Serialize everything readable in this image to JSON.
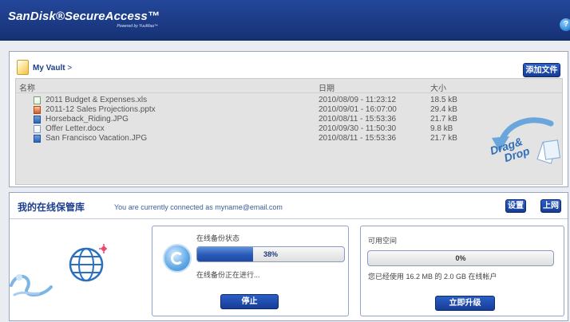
{
  "header": {
    "logo": "SanDisk®SecureAccess™",
    "logo_tagline": "Powered by YuuWaa™",
    "help_icon": "help-icon",
    "colors": {
      "bar": "#1c3b86"
    }
  },
  "vault": {
    "breadcrumb": "My Vault",
    "breadcrumb_separator": ">",
    "add_file_label": "添加文件",
    "columns": {
      "name": "名称",
      "date": "日期",
      "size": "大小"
    },
    "files": [
      {
        "icon": "xls-file-icon",
        "name": "2011 Budget & Expenses.xls",
        "date": "2010/08/09 - 11:23:12",
        "size": "18.5 kB"
      },
      {
        "icon": "ppt-file-icon",
        "name": "2011-12 Sales Projections.pptx",
        "date": "2010/09/01 - 16:07:00",
        "size": "29.4 kB"
      },
      {
        "icon": "jpg-file-icon",
        "name": "Horseback_Riding.JPG",
        "date": "2010/08/11 - 15:53:36",
        "size": "21.7 kB"
      },
      {
        "icon": "doc-file-icon",
        "name": "Offer Letter.docx",
        "date": "2010/09/30 - 11:50:30",
        "size": "9.8 kB"
      },
      {
        "icon": "jpg-file-icon",
        "name": "San Francisco Vacation.JPG",
        "date": "2010/08/11 - 15:53:36",
        "size": "21.7 kB"
      }
    ],
    "drag_drop": [
      "Drag&",
      "Drop"
    ]
  },
  "online": {
    "title": "我的在线保管库",
    "connection_text": "You are currently connected as myname@email.com",
    "settings_label": "设置",
    "online_label": "上网",
    "backup": {
      "status_label": "在线备份状态",
      "progress_percent": 38,
      "progress_text": "38%",
      "activity_text": "在线备份正在进行...",
      "stop_label": "停止"
    },
    "space": {
      "title": "可用空间",
      "used_percent": 0,
      "used_text": "0%",
      "usage_text": "您已经使用 16.2 MB 的 2.0 GB 在线帐户",
      "upgrade_label": "立即升级"
    }
  }
}
